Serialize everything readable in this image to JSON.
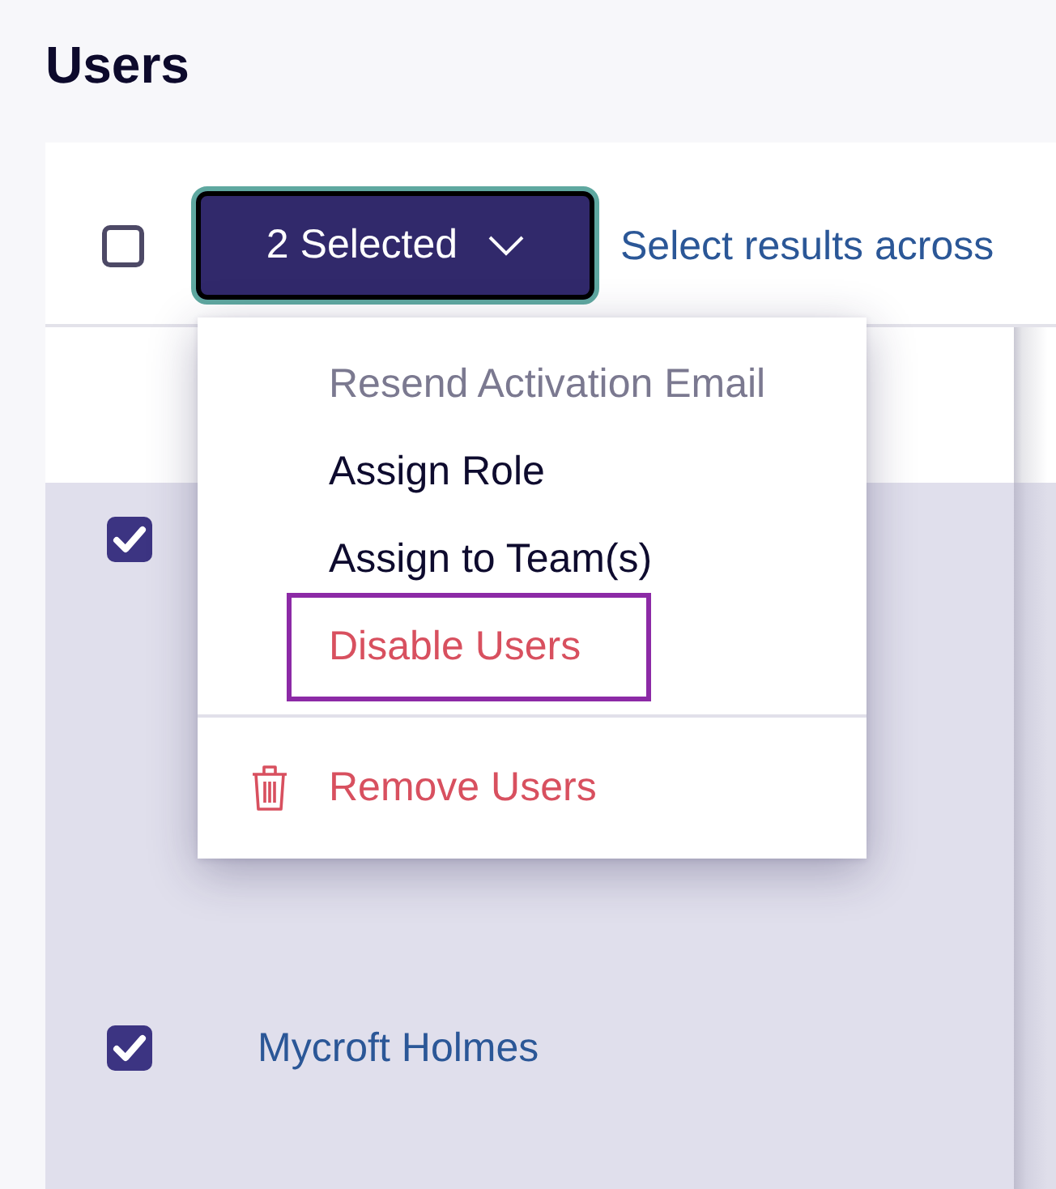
{
  "page": {
    "title": "Users"
  },
  "toolbar": {
    "select_all": {
      "checked": false
    },
    "selection_button": {
      "label": "2 Selected",
      "expanded": true
    },
    "select_all_link": "Select results across"
  },
  "menu": {
    "groups": [
      {
        "items": [
          {
            "label": "Resend Activation Email",
            "kind": "default",
            "disabled": true,
            "highlighted": false
          },
          {
            "label": "Assign Role",
            "kind": "default",
            "disabled": false,
            "highlighted": false
          },
          {
            "label": "Assign to Team(s)",
            "kind": "default",
            "disabled": false,
            "highlighted": false
          },
          {
            "label": "Disable Users",
            "kind": "danger",
            "disabled": false,
            "highlighted": true
          }
        ]
      },
      {
        "items": [
          {
            "label": "Remove Users",
            "kind": "delete",
            "disabled": false,
            "highlighted": false
          }
        ]
      }
    ]
  },
  "table": {
    "rows": [
      {
        "selected": true
      },
      {
        "selected": true,
        "name": "Mycroft Holmes"
      }
    ]
  }
}
